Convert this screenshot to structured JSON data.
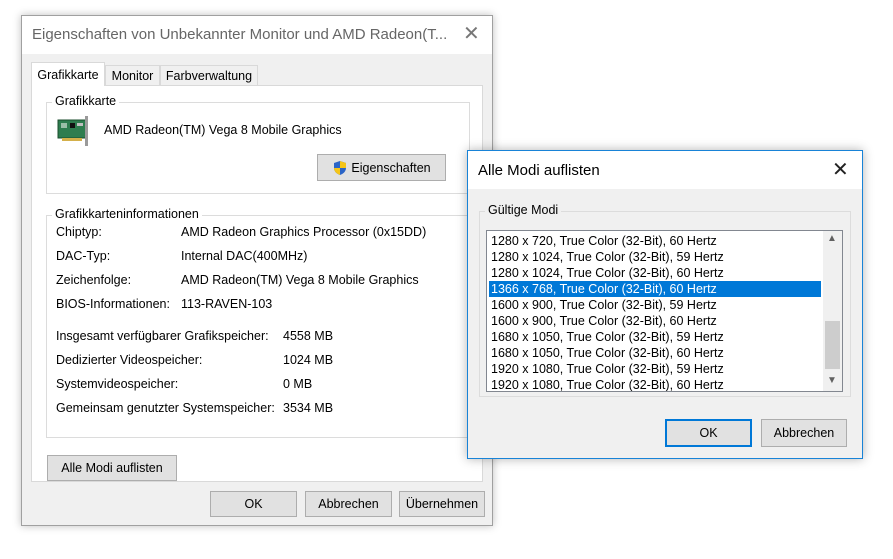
{
  "main_dialog": {
    "title": "Eigenschaften von Unbekannter Monitor und AMD Radeon(T...",
    "tabs": [
      "Grafikkarte",
      "Monitor",
      "Farbverwaltung"
    ],
    "adapter_group": {
      "legend": "Grafikkarte",
      "adapter_name": "AMD Radeon(TM) Vega 8 Mobile Graphics",
      "properties_button": "Eigenschaften"
    },
    "info_group": {
      "legend": "Grafikkarteninformationen",
      "rows": [
        {
          "label": "Chiptyp:",
          "value": "AMD Radeon Graphics Processor (0x15DD)"
        },
        {
          "label": "DAC-Typ:",
          "value": "Internal DAC(400MHz)"
        },
        {
          "label": "Zeichenfolge:",
          "value": "AMD Radeon(TM) Vega 8 Mobile Graphics"
        },
        {
          "label": "BIOS-Informationen:",
          "value": "113-RAVEN-103"
        }
      ],
      "memory_rows": [
        {
          "label": "Insgesamt verfügbarer Grafikspeicher:",
          "value": "4558 MB"
        },
        {
          "label": "Dedizierter Videospeicher:",
          "value": "1024 MB"
        },
        {
          "label": "Systemvideospeicher:",
          "value": "0 MB"
        },
        {
          "label": "Gemeinsam genutzter Systemspeicher:",
          "value": "3534 MB"
        }
      ]
    },
    "list_all_modes_button": "Alle Modi auflisten",
    "ok_button": "OK",
    "cancel_button": "Abbrechen",
    "apply_button": "Übernehmen"
  },
  "modes_dialog": {
    "title": "Alle Modi auflisten",
    "group_legend": "Gültige Modi",
    "modes": [
      "1280 x 720, True Color (32-Bit), 60 Hertz",
      "1280 x 1024, True Color (32-Bit), 59 Hertz",
      "1280 x 1024, True Color (32-Bit), 60 Hertz",
      "1366 x 768, True Color (32-Bit), 60 Hertz",
      "1600 x 900, True Color (32-Bit), 59 Hertz",
      "1600 x 900, True Color (32-Bit), 60 Hertz",
      "1680 x 1050, True Color (32-Bit), 59 Hertz",
      "1680 x 1050, True Color (32-Bit), 60 Hertz",
      "1920 x 1080, True Color (32-Bit), 59 Hertz",
      "1920 x 1080, True Color (32-Bit), 60 Hertz"
    ],
    "selected_index": 3,
    "ok_button": "OK",
    "cancel_button": "Abbrechen"
  },
  "colors": {
    "selection": "#0078d7",
    "default_button_border": "#0078d7",
    "dialog_bg": "#f0f0f0"
  }
}
